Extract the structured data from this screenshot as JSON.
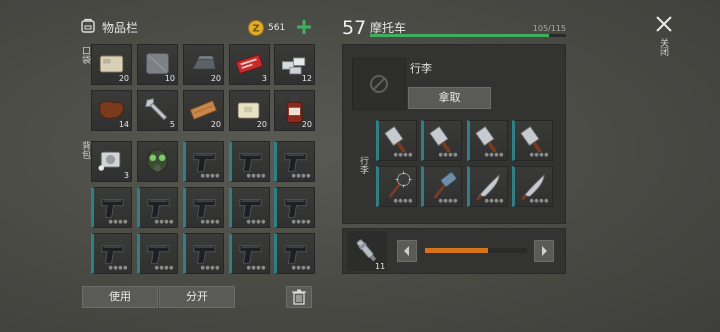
{
  "inventory": {
    "title": "物品栏",
    "coins": "561",
    "pocket_label": "口袋",
    "backpack_label": "背包",
    "use_label": "使用",
    "split_label": "分开",
    "pocket_items": [
      {
        "icon": "stone-block-icon",
        "count": "20"
      },
      {
        "icon": "metal-plate-icon",
        "count": "10"
      },
      {
        "icon": "iron-ingot-icon",
        "count": "20"
      },
      {
        "icon": "red-ticket-icon",
        "count": "3"
      },
      {
        "icon": "silver-bars-icon",
        "count": "12"
      },
      {
        "icon": "leather-icon",
        "count": "14"
      },
      {
        "icon": "wrench-icon",
        "count": "5"
      },
      {
        "icon": "wood-plank-icon",
        "count": "20"
      },
      {
        "icon": "limestone-icon",
        "count": "20"
      },
      {
        "icon": "medicine-bottle-icon",
        "count": "20"
      }
    ],
    "backpack_items": [
      {
        "icon": "engine-part-icon",
        "count": "3"
      },
      {
        "icon": "gas-mask-icon",
        "count": ""
      },
      {
        "icon": "pistol-icon",
        "count": ""
      },
      {
        "icon": "pistol-icon",
        "count": ""
      },
      {
        "icon": "pistol-icon",
        "count": ""
      },
      {
        "icon": "pistol-icon",
        "count": ""
      },
      {
        "icon": "pistol-icon",
        "count": ""
      },
      {
        "icon": "pistol-icon",
        "count": ""
      },
      {
        "icon": "pistol-icon",
        "count": ""
      },
      {
        "icon": "pistol-icon",
        "count": ""
      },
      {
        "icon": "pistol-icon",
        "count": ""
      },
      {
        "icon": "pistol-icon",
        "count": ""
      },
      {
        "icon": "pistol-icon",
        "count": ""
      },
      {
        "icon": "pistol-icon",
        "count": ""
      },
      {
        "icon": "pistol-icon",
        "count": ""
      }
    ]
  },
  "vehicle": {
    "level": "57",
    "name": "摩托车",
    "hp_text": "105/115",
    "hp_fraction": 0.913,
    "luggage_label": "行李",
    "take_label": "拿取",
    "side_label": "行李",
    "slots": [
      {
        "icon": "cleaver-icon"
      },
      {
        "icon": "cleaver-icon"
      },
      {
        "icon": "cleaver-icon"
      },
      {
        "icon": "cleaver-icon"
      },
      {
        "icon": "spiked-mace-icon"
      },
      {
        "icon": "sledgehammer-icon"
      },
      {
        "icon": "machete-icon"
      },
      {
        "icon": "machete-icon"
      }
    ],
    "fuel_count": "11",
    "fuel_fraction": 0.62
  },
  "close_label": "关闭",
  "colors": {
    "accent_green": "#3fae5f",
    "accent_orange": "#d6741c",
    "weapon_border": "#2f7f86"
  }
}
